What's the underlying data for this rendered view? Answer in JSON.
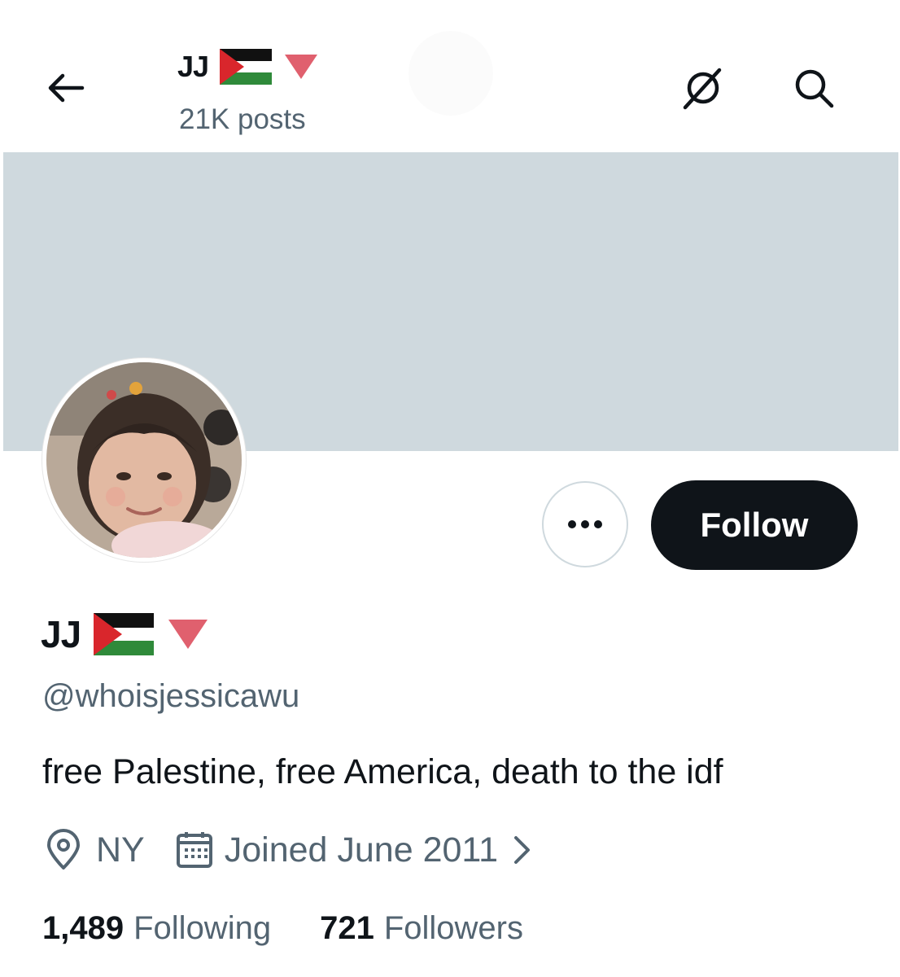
{
  "header": {
    "display_name": "JJ",
    "posts_count": "21K posts",
    "back_icon": "arrow-left-icon",
    "grok_icon": "grok-icon",
    "search_icon": "search-icon"
  },
  "profile": {
    "display_name": "JJ",
    "handle": "@whoisjessicawu",
    "bio": "free Palestine, free America, death to the idf",
    "location": "NY",
    "joined": "Joined June 2011",
    "following_count": "1,489",
    "following_label": "Following",
    "followers_count": "721",
    "followers_label": "Followers"
  },
  "actions": {
    "follow_label": "Follow",
    "more_icon": "more-icon"
  },
  "colors": {
    "banner": "#cfd9de",
    "primary_text": "#0f1419",
    "secondary_text": "#536471",
    "follow_bg": "#0f1419",
    "triangle": "#e0606e"
  }
}
